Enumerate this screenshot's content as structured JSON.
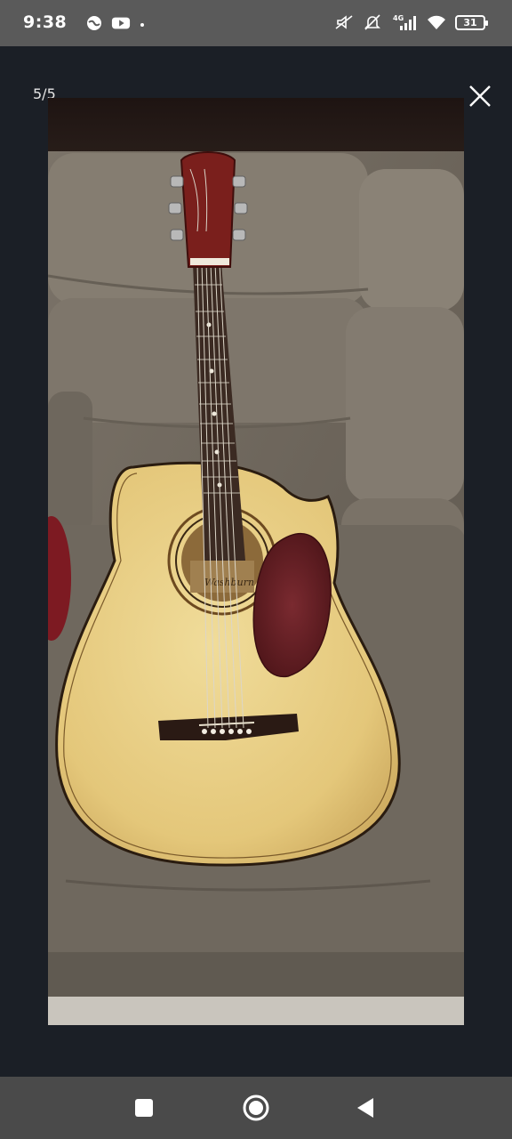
{
  "status_bar": {
    "time": "9:38",
    "left_icons": [
      "browser-icon",
      "youtube-icon",
      "dot-icon"
    ],
    "right_icons": [
      "mute-icon",
      "no-alarm-icon",
      "signal-4g-icon",
      "wifi-icon"
    ],
    "network_label": "4G",
    "battery_level": "31"
  },
  "viewer": {
    "counter": "5/5",
    "close_icon": "close-icon",
    "photo_description_icon": "guitar-photo"
  },
  "guitar": {
    "brand_label": "Washburn"
  },
  "nav_bar": {
    "buttons": [
      "recents-icon",
      "home-icon",
      "back-icon"
    ]
  },
  "colors": {
    "status_bar_bg": "#5a5a5a",
    "viewer_bg": "#1b1f26",
    "nav_bar_bg": "#4a4a4a"
  }
}
